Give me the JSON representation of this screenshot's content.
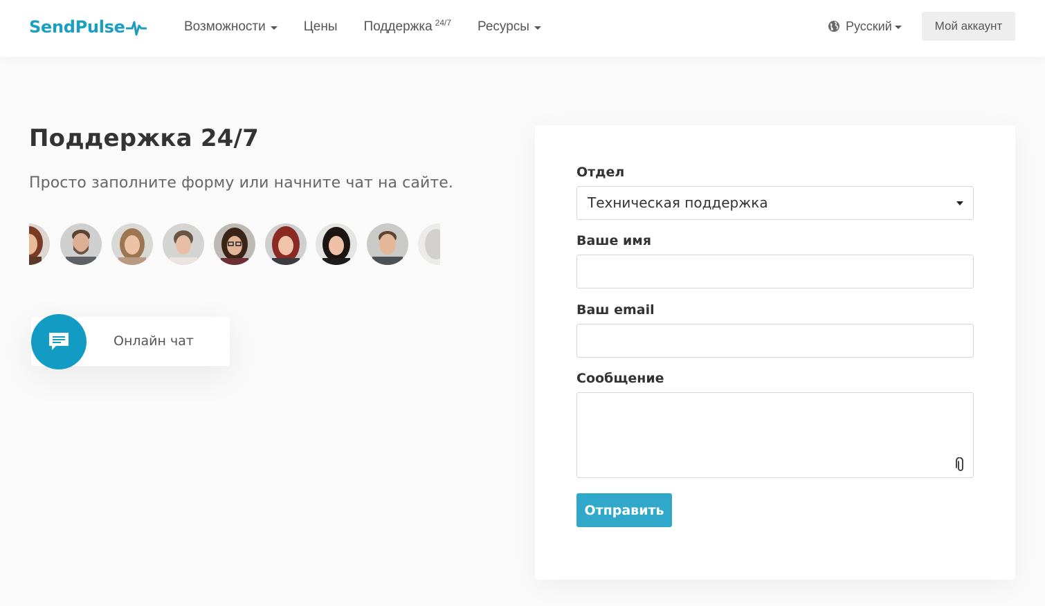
{
  "header": {
    "logo_text": "SendPulse",
    "nav": [
      {
        "label": "Возможности",
        "has_dropdown": true
      },
      {
        "label": "Цены",
        "has_dropdown": false
      },
      {
        "label": "Поддержка",
        "sup": "24/7",
        "has_dropdown": false
      },
      {
        "label": "Ресурсы",
        "has_dropdown": true
      }
    ],
    "language": "Русский",
    "account_button": "Мой аккаунт"
  },
  "hero": {
    "title": "Поддержка 24/7",
    "subtitle": "Просто заполните форму или начните чат на сайте."
  },
  "chat": {
    "label": "Онлайн чат",
    "icon": "chat-bubble-icon"
  },
  "form": {
    "department_label": "Отдел",
    "department_value": "Техническая поддержка",
    "name_label": "Ваше имя",
    "name_value": "",
    "email_label": "Ваш email",
    "email_value": "",
    "message_label": "Сообщение",
    "message_value": "",
    "attach_icon": "paperclip-icon",
    "submit_label": "Отправить"
  },
  "colors": {
    "brand": "#1a9fc0",
    "chat_circle": "#139cc3",
    "submit": "#2fa8c9"
  }
}
